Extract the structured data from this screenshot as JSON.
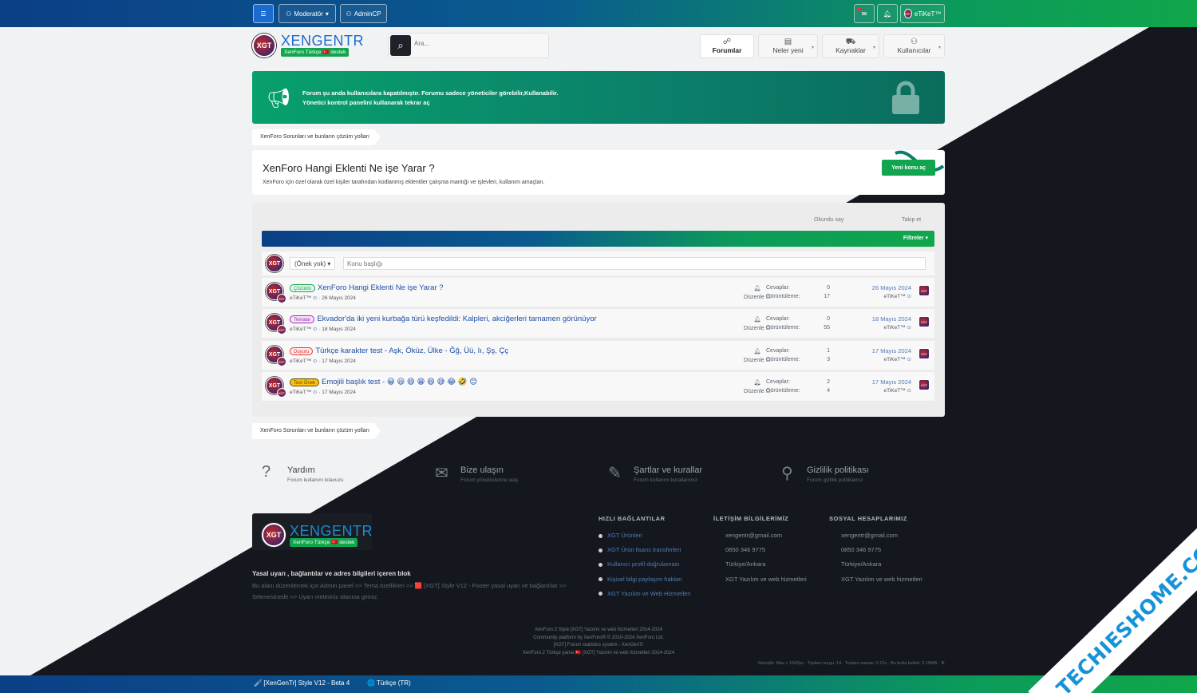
{
  "topbar": {
    "moderator_label": "Moderatör",
    "admin_label": "AdminCP",
    "user_label": "eTiKeT™"
  },
  "header": {
    "logo_badge": "XGT",
    "logo_title": "XENGENTR",
    "logo_subtitle": "XenForo Türkçe 🇹🇷 destek",
    "search_placeholder": "Ara...",
    "nav": [
      {
        "label": "Forumlar",
        "icon": "☍"
      },
      {
        "label": "Neler yeni",
        "icon": "▤"
      },
      {
        "label": "Kaynaklar",
        "icon": "⛟"
      },
      {
        "label": "Kullanıcılar",
        "icon": "⚇"
      }
    ]
  },
  "notice": {
    "line1": "Forum şu anda kullanıcılara kapatılmıştır. Forumu sadece yöneticiler görebilir,Kullanabilir.",
    "line2": "Yönetici kontrol panelini kullanarak tekrar aç"
  },
  "breadcrumb": "XenForo Sorunları ve bunların çözüm yolları",
  "forum": {
    "title": "XenForo Hangi Eklenti Ne işe Yarar ?",
    "description": "XenForo için özel olarak özel kişiler tarafından kodlanmış eklentiler çalışma mantığı ve işlevleri, kullanım amaçları.",
    "new_thread": "Yeni konu aç",
    "mark_read": "Okundu say",
    "watch": "Takip et",
    "filters": "Filtreler ▾",
    "prefix_select": "(Önek yok)",
    "title_placeholder": "Konu başlığı"
  },
  "threads": [
    {
      "prefix": "Çözüldü",
      "prefix_color": "#12a54f",
      "prefix_bg": "#e8f7ee",
      "title": "XenForo Hangi Eklenti Ne işe Yarar ?",
      "author": "eTiKeT™",
      "date": "26 Mayıs 2024",
      "replies_label": "Cevaplar:",
      "replies": "0",
      "views_label": "Görüntüleme:",
      "views": "17",
      "last_date": "26 Mayıs 2024",
      "last_user": "eTiKeT™",
      "watch_label": "Düzenle"
    },
    {
      "prefix": "Temalar",
      "prefix_color": "#9c27b0",
      "prefix_bg": "#f6e8f9",
      "title": "Ekvador'da iki yeni kurbağa türü keşfedildi: Kalpleri, akciğerleri tamamen görünüyor",
      "author": "eTiKeT™",
      "date": "18 Mayıs 2024",
      "replies_label": "Cevaplar:",
      "replies": "0",
      "views_label": "Görüntüleme:",
      "views": "55",
      "last_date": "18 Mayıs 2024",
      "last_user": "eTiKeT™",
      "watch_label": "Düzenle"
    },
    {
      "prefix": "Duyuru",
      "prefix_color": "#e53935",
      "prefix_bg": "#fdeaea",
      "title": "Türkçe karakter test - Aşk, Öküz, Ülke - Ğğ, Üü, Iı, Şş, Çç",
      "author": "eTiKeT™",
      "date": "17 Mayıs 2024",
      "replies_label": "Cevaplar:",
      "replies": "1",
      "views_label": "Görüntüleme:",
      "views": "3",
      "last_date": "17 Mayıs 2024",
      "last_user": "eTiKeT™",
      "watch_label": "Düzenle"
    },
    {
      "prefix": "Test Önek",
      "prefix_color": "#5d4a00",
      "prefix_bg": "#ffc107",
      "title": "Emojili başlık test - 😀 😃 😄 😁 😆 😅 😂 🤣 😊",
      "author": "eTiKeT™",
      "date": "17 Mayıs 2024",
      "replies_label": "Cevaplar:",
      "replies": "2",
      "views_label": "Görüntüleme:",
      "views": "4",
      "last_date": "17 Mayıs 2024",
      "last_user": "eTiKeT™",
      "watch_label": "Düzenle"
    }
  ],
  "help": [
    {
      "icon": "?",
      "title": "Yardım",
      "sub": "Forum kullanım kılavuzu"
    },
    {
      "icon": "✉",
      "title": "Bize ulaşın",
      "sub": "Forum yöneticilerine ulaş"
    },
    {
      "icon": "✎",
      "title": "Şartlar ve kurallar",
      "sub": "Forum kullanım kurallarımız"
    },
    {
      "icon": "⚲",
      "title": "Gizlilik politikası",
      "sub": "Forum gizlilik politikamız"
    }
  ],
  "footer": {
    "title": "Yasal uyarı , bağlantılar ve adres bilgileri içeren blok",
    "text": "Bu alanı düzenlemek için Admin panel >> Tema özellikleri >> 🟥 [XGT] Style V12 - Footer yasal uyarı ve bağlantılar >> Sekmesinede >> Uyarı metininiz alanına giriniz.",
    "quick_title": "HIZLI BAĞLANTILAR",
    "quick_links": [
      "XGT Ürünleri",
      "XGT Ürün lisans transferleri",
      "Kullanıcı profil doğrulaması",
      "Kişisel bilgi paylaşım hakları",
      "XGT Yazılım ve Web Hizmetleri"
    ],
    "contact_title": "İLETİŞİM BİLGİLERİMİZ",
    "contact": [
      "xengentr@gmail.com",
      "0850 346 9775",
      "Türkiye/Ankara",
      "XGT Yazılım ve web hizmetleri"
    ],
    "social_title": "SOSYAL HESAPLARIMIZ",
    "social": [
      "xengentr@gmail.com",
      "0850 346 9775",
      "Türkiye/Ankara",
      "XGT Yazılım ve web hizmetleri"
    ],
    "copyright": [
      "XenForo 2 Style [XGT] Yazılım ve web hizmetleri 2014-2024",
      "Community platform by XenForo® © 2010-2024 XenForo Ltd.",
      "[XGT] Forum statistics system - XenGenTr",
      "XenForo 2 Türkçe yama 🇹🇷 [XGT] Yazılım ve web hizmetleri 2014-2024"
    ],
    "debug": "Genişlik: Max > 1500px · Toplam sorgu: 14 · Toplam zaman: 0.12s · Bu koda bellek: 2.16MB · ⚙"
  },
  "bottombar": {
    "style": "🖌 [XenGenTr] Style V12 - Beta 4",
    "language": "🌐 Türkçe (TR)"
  },
  "watermark": "TECHIESHOME.COM"
}
